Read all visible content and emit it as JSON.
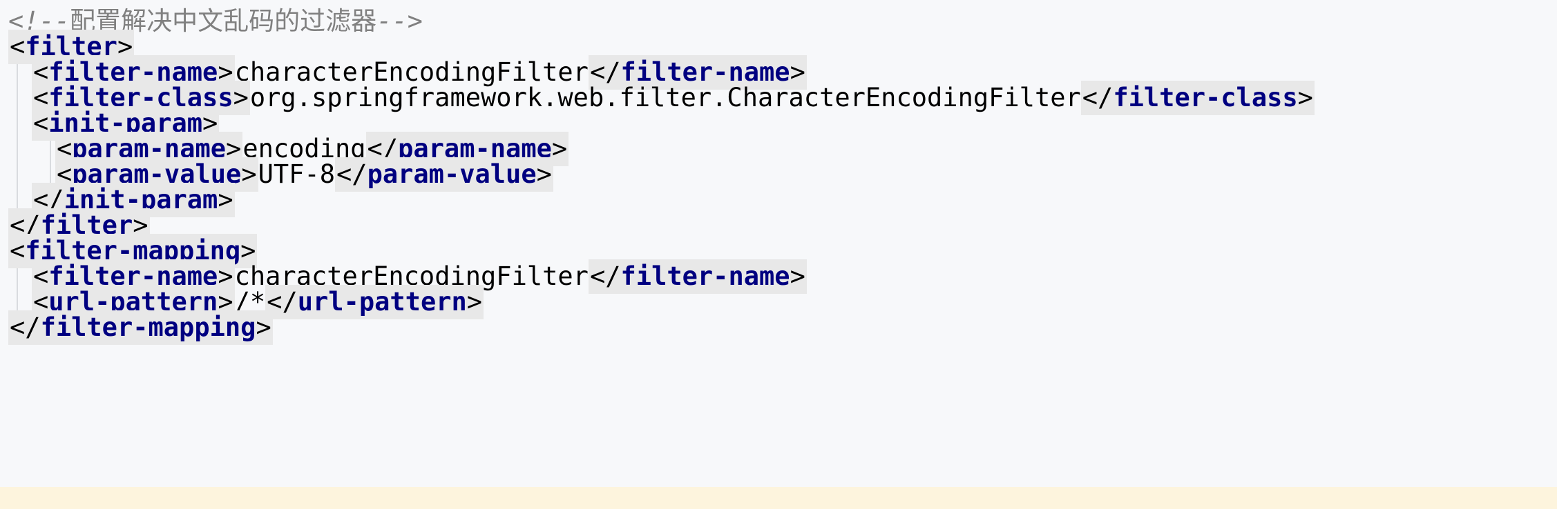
{
  "editor": {
    "comment": {
      "open": "<!--",
      "text": "配置解决中文乱码的过滤器",
      "close": "-->"
    },
    "lines": [
      {
        "kind": "open",
        "tag": "filter"
      },
      {
        "kind": "elem",
        "tag": "filter-name",
        "value": "characterEncodingFilter"
      },
      {
        "kind": "elem",
        "tag": "filter-class",
        "value": "org.springframework.web.filter.CharacterEncodingFilter"
      },
      {
        "kind": "open",
        "tag": "init-param"
      },
      {
        "kind": "elem",
        "tag": "param-name",
        "value": "encoding"
      },
      {
        "kind": "elem",
        "tag": "param-value",
        "value": "UTF-8"
      },
      {
        "kind": "close",
        "tag": "init-param"
      },
      {
        "kind": "close",
        "tag": "filter"
      },
      {
        "kind": "open",
        "tag": "filter-mapping"
      },
      {
        "kind": "elem",
        "tag": "filter-name",
        "value": "characterEncodingFilter"
      },
      {
        "kind": "elem",
        "tag": "url-pattern",
        "value": "/*"
      },
      {
        "kind": "close",
        "tag": "filter-mapping"
      }
    ]
  },
  "colors": {
    "background": "#f7f8fa",
    "tag_text": "#000080",
    "tag_background": "#e8e8e8",
    "comment": "#808080",
    "current_line": "#fdf4dd"
  }
}
